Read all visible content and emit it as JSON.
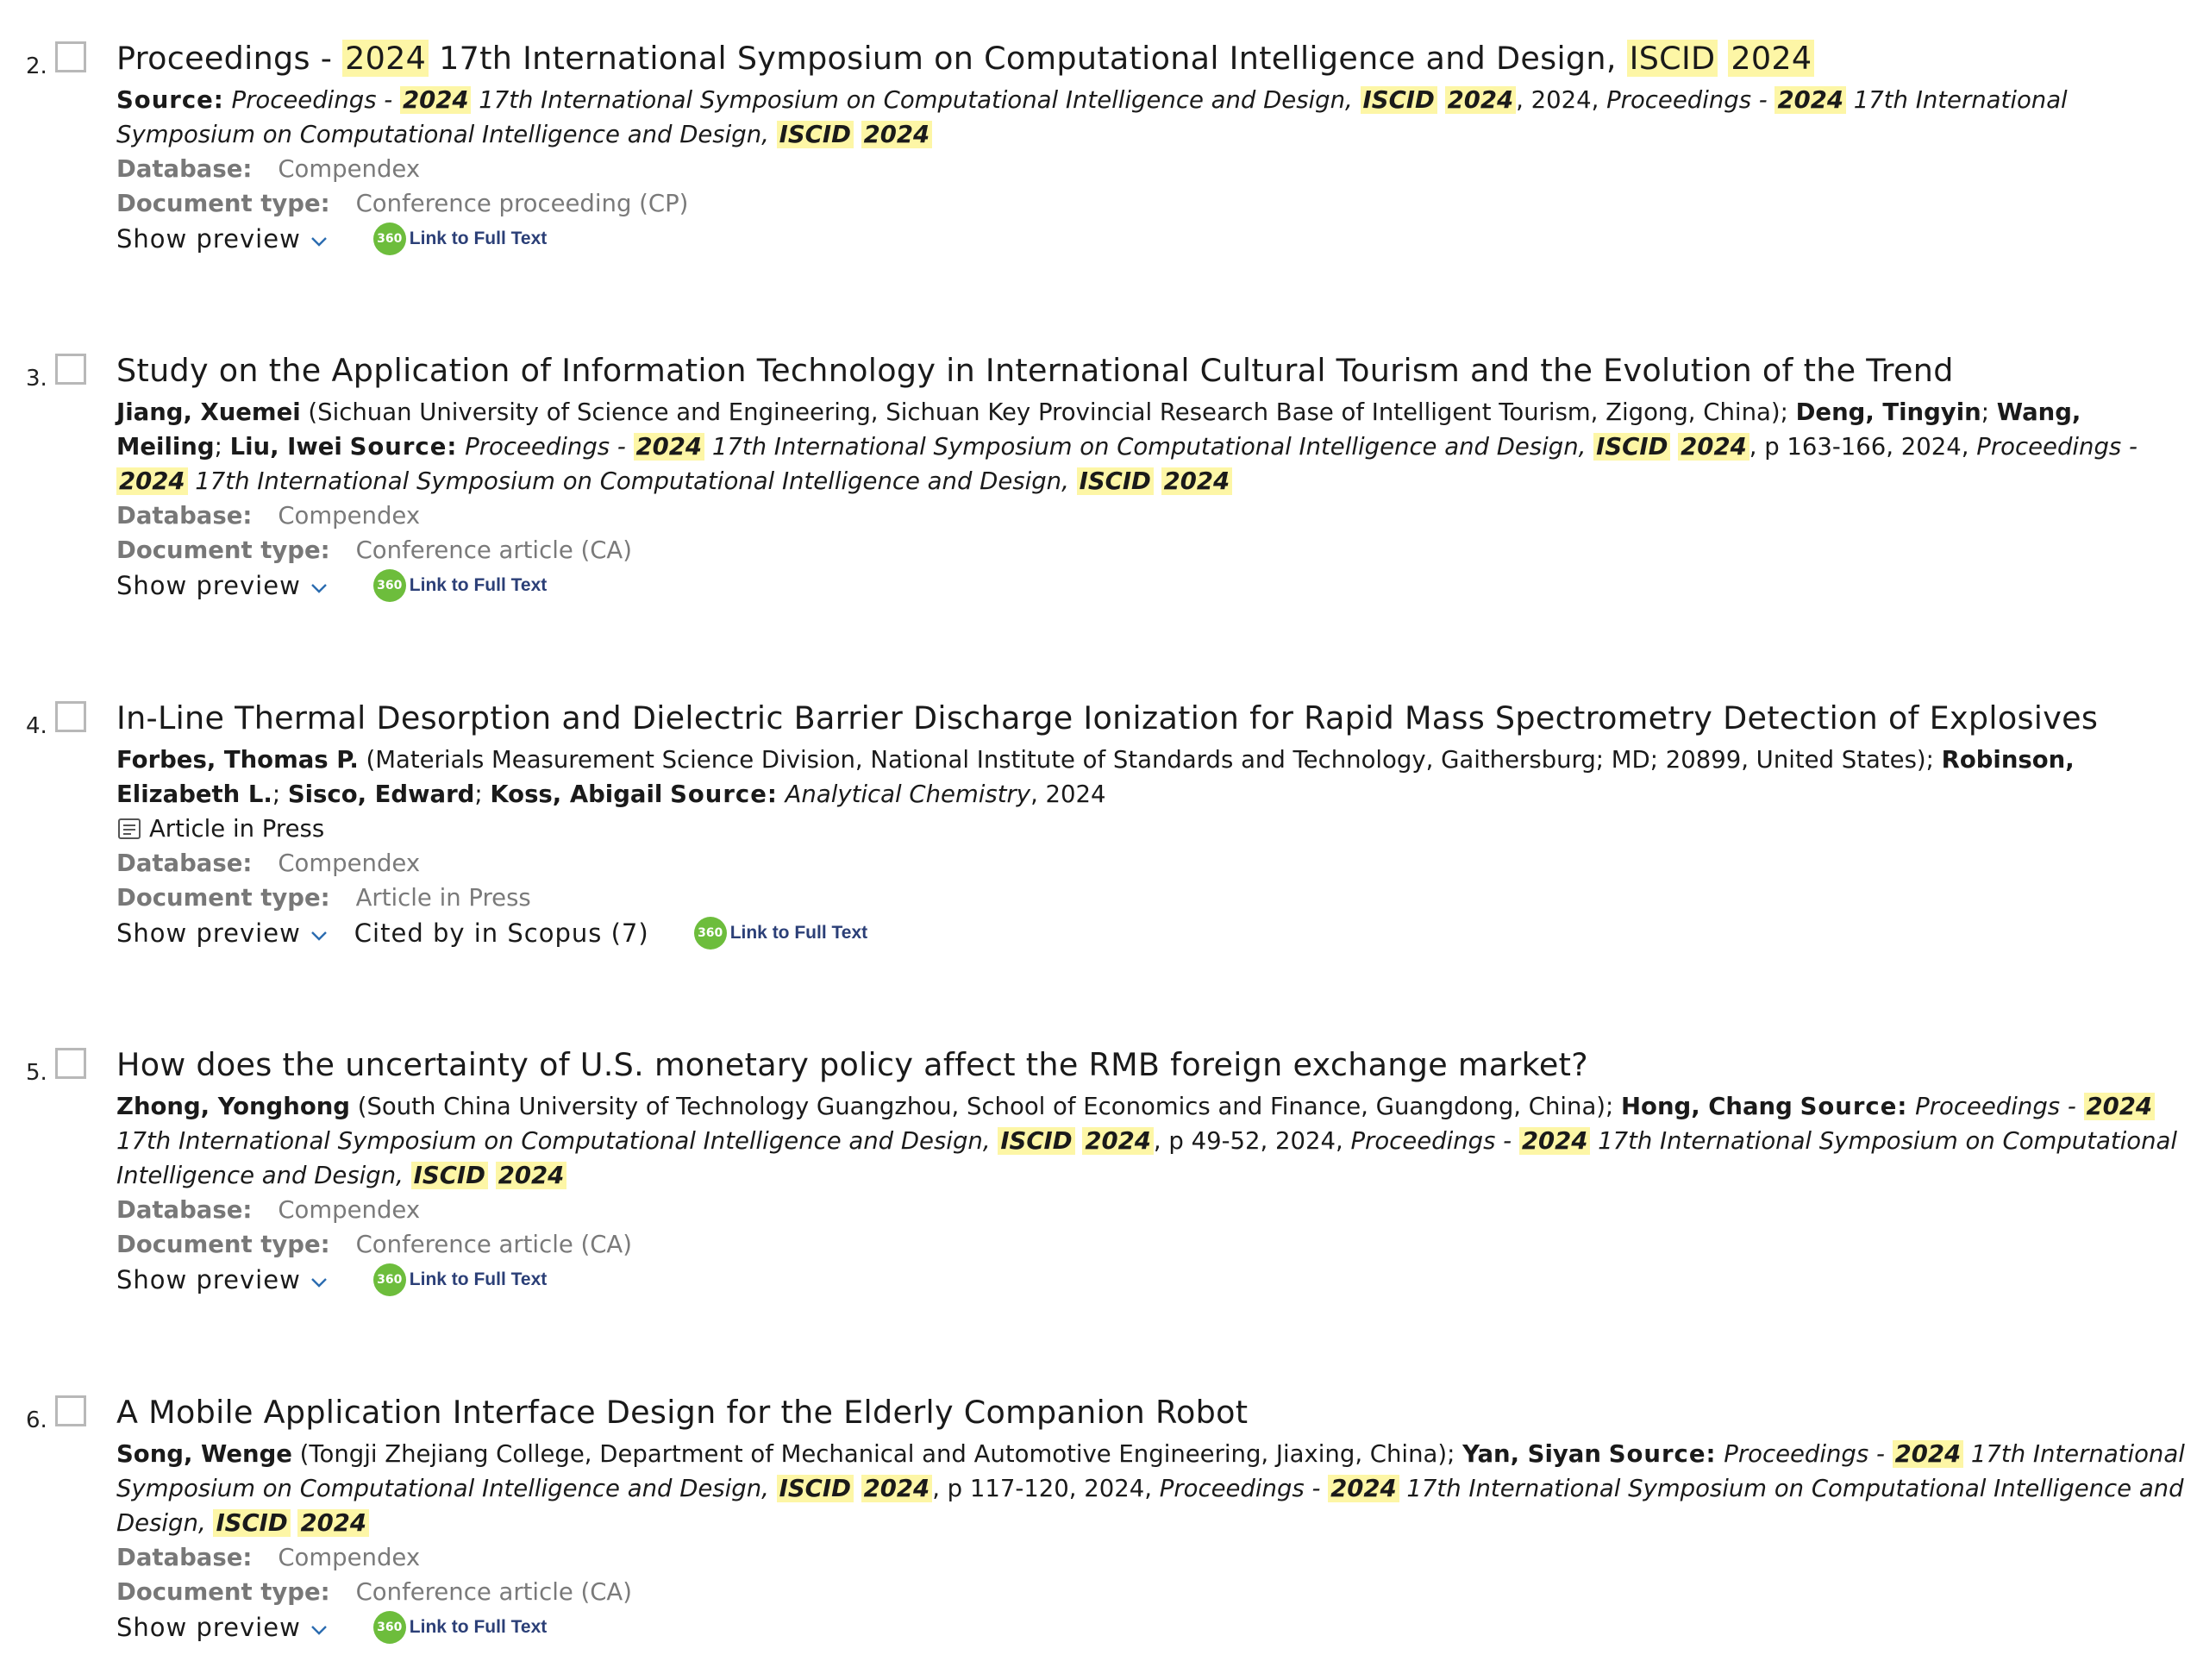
{
  "ui": {
    "labels": {
      "source": "Source:",
      "database": "Database:",
      "doctype": "Document type:",
      "show_preview": "Show preview",
      "full_text_badge": "360",
      "full_text": "Link to Full Text"
    }
  },
  "results": [
    {
      "number": "2.",
      "title": [
        {
          "t": "Proceedings - "
        },
        {
          "t": "2024",
          "hl": 1
        },
        {
          "t": " 17th International Symposium on Computational Intelligence and Design, "
        },
        {
          "t": "ISCID",
          "hl": 1
        },
        {
          "t": " "
        },
        {
          "t": "2024",
          "hl": 1
        }
      ],
      "citation": [
        {
          "t": "Source:",
          "s": "lbl"
        },
        {
          "t": " "
        },
        {
          "t": "Proceedings - ",
          "s": "i"
        },
        {
          "t": "2024",
          "s": "i",
          "hl": 1,
          "b": 1
        },
        {
          "t": " 17th International Symposium on Computational Intelligence and Design, ",
          "s": "i"
        },
        {
          "t": "ISCID",
          "s": "i",
          "hl": 1,
          "b": 1
        },
        {
          "t": " ",
          "s": "i"
        },
        {
          "t": "2024",
          "s": "i",
          "hl": 1,
          "b": 1
        },
        {
          "t": ", 2024, "
        },
        {
          "t": "Proceedings - ",
          "s": "i"
        },
        {
          "t": "2024",
          "s": "i",
          "hl": 1,
          "b": 1
        },
        {
          "t": " 17th International Symposium on Computational Intelligence and Design, ",
          "s": "i"
        },
        {
          "t": "ISCID",
          "s": "i",
          "hl": 1,
          "b": 1
        },
        {
          "t": " ",
          "s": "i"
        },
        {
          "t": "2024",
          "s": "i",
          "hl": 1,
          "b": 1
        }
      ],
      "status": "",
      "database": "Compendex",
      "doctype": "Conference proceeding (CP)",
      "cited_by": ""
    },
    {
      "number": "3.",
      "title": [
        {
          "t": "Study on the Application of Information Technology in International Cultural Tourism and the Evolution of the Trend"
        }
      ],
      "citation": [
        {
          "t": "Jiang, Xuemei",
          "s": "b"
        },
        {
          "t": " (Sichuan University of Science and Engineering, Sichuan Key Provincial Research Base of Intelligent Tourism, Zigong, China); "
        },
        {
          "t": "Deng, Tingyin",
          "s": "b"
        },
        {
          "t": "; "
        },
        {
          "t": "Wang, Meiling",
          "s": "b"
        },
        {
          "t": "; "
        },
        {
          "t": "Liu, Iwei",
          "s": "b"
        },
        {
          "t": " "
        },
        {
          "t": "Source:",
          "s": "lbl"
        },
        {
          "t": " "
        },
        {
          "t": "Proceedings - ",
          "s": "i"
        },
        {
          "t": "2024",
          "s": "i",
          "hl": 1,
          "b": 1
        },
        {
          "t": " 17th International Symposium on Computational Intelligence and Design, ",
          "s": "i"
        },
        {
          "t": "ISCID",
          "s": "i",
          "hl": 1,
          "b": 1
        },
        {
          "t": " ",
          "s": "i"
        },
        {
          "t": "2024",
          "s": "i",
          "hl": 1,
          "b": 1
        },
        {
          "t": ", p 163-166, 2024, "
        },
        {
          "t": "Proceedings - ",
          "s": "i"
        },
        {
          "t": "2024",
          "s": "i",
          "hl": 1,
          "b": 1
        },
        {
          "t": " 17th International Symposium on Computational Intelligence and Design, ",
          "s": "i"
        },
        {
          "t": "ISCID",
          "s": "i",
          "hl": 1,
          "b": 1
        },
        {
          "t": " ",
          "s": "i"
        },
        {
          "t": "2024",
          "s": "i",
          "hl": 1,
          "b": 1
        }
      ],
      "status": "",
      "database": "Compendex",
      "doctype": "Conference article (CA)",
      "cited_by": ""
    },
    {
      "number": "4.",
      "title": [
        {
          "t": "In-Line Thermal Desorption and Dielectric Barrier Discharge Ionization for Rapid Mass Spectrometry Detection of Explosives"
        }
      ],
      "citation": [
        {
          "t": "Forbes, Thomas P.",
          "s": "b"
        },
        {
          "t": " (Materials Measurement Science Division, National Institute of Standards and Technology, Gaithersburg; MD; 20899, United States); "
        },
        {
          "t": "Robinson, Elizabeth L.",
          "s": "b"
        },
        {
          "t": "; "
        },
        {
          "t": "Sisco, Edward",
          "s": "b"
        },
        {
          "t": "; "
        },
        {
          "t": "Koss, Abigail",
          "s": "b"
        },
        {
          "t": " "
        },
        {
          "t": "Source:",
          "s": "lbl"
        },
        {
          "t": " "
        },
        {
          "t": "Analytical Chemistry",
          "s": "i"
        },
        {
          "t": ", 2024"
        }
      ],
      "status": "Article in Press",
      "database": "Compendex",
      "doctype": "Article in Press",
      "cited_by": "Cited by in Scopus (7)"
    },
    {
      "number": "5.",
      "title": [
        {
          "t": "How does the uncertainty of U.S. monetary policy affect the RMB foreign exchange market?"
        }
      ],
      "citation": [
        {
          "t": "Zhong, Yonghong",
          "s": "b"
        },
        {
          "t": " (South China University of Technology Guangzhou, School of Economics and Finance, Guangdong, China); "
        },
        {
          "t": "Hong, Chang",
          "s": "b"
        },
        {
          "t": " "
        },
        {
          "t": "Source:",
          "s": "lbl"
        },
        {
          "t": " "
        },
        {
          "t": "Proceedings - ",
          "s": "i"
        },
        {
          "t": "2024",
          "s": "i",
          "hl": 1,
          "b": 1
        },
        {
          "t": " 17th International Symposium on Computational Intelligence and Design, ",
          "s": "i"
        },
        {
          "t": "ISCID",
          "s": "i",
          "hl": 1,
          "b": 1
        },
        {
          "t": " ",
          "s": "i"
        },
        {
          "t": "2024",
          "s": "i",
          "hl": 1,
          "b": 1
        },
        {
          "t": ", p 49-52, 2024, "
        },
        {
          "t": "Proceedings - ",
          "s": "i"
        },
        {
          "t": "2024",
          "s": "i",
          "hl": 1,
          "b": 1
        },
        {
          "t": " 17th International Symposium on Computational Intelligence and Design, ",
          "s": "i"
        },
        {
          "t": "ISCID",
          "s": "i",
          "hl": 1,
          "b": 1
        },
        {
          "t": " ",
          "s": "i"
        },
        {
          "t": "2024",
          "s": "i",
          "hl": 1,
          "b": 1
        }
      ],
      "status": "",
      "database": "Compendex",
      "doctype": "Conference article (CA)",
      "cited_by": ""
    },
    {
      "number": "6.",
      "title": [
        {
          "t": "A Mobile Application Interface Design for the Elderly Companion Robot"
        }
      ],
      "citation": [
        {
          "t": "Song, Wenge",
          "s": "b"
        },
        {
          "t": " (Tongji Zhejiang College, Department of Mechanical and Automotive Engineering, Jiaxing, China); "
        },
        {
          "t": "Yan, Siyan",
          "s": "b"
        },
        {
          "t": " "
        },
        {
          "t": "Source:",
          "s": "lbl"
        },
        {
          "t": " "
        },
        {
          "t": "Proceedings - ",
          "s": "i"
        },
        {
          "t": "2024",
          "s": "i",
          "hl": 1,
          "b": 1
        },
        {
          "t": " 17th International Symposium on Computational Intelligence and Design, ",
          "s": "i"
        },
        {
          "t": "ISCID",
          "s": "i",
          "hl": 1,
          "b": 1
        },
        {
          "t": " ",
          "s": "i"
        },
        {
          "t": "2024",
          "s": "i",
          "hl": 1,
          "b": 1
        },
        {
          "t": ", p 117-120, 2024, "
        },
        {
          "t": "Proceedings - ",
          "s": "i"
        },
        {
          "t": "2024",
          "s": "i",
          "hl": 1,
          "b": 1
        },
        {
          "t": " 17th International Symposium on Computational Intelligence and Design, ",
          "s": "i"
        },
        {
          "t": "ISCID",
          "s": "i",
          "hl": 1,
          "b": 1
        },
        {
          "t": " ",
          "s": "i"
        },
        {
          "t": "2024",
          "s": "i",
          "hl": 1,
          "b": 1
        }
      ],
      "status": "",
      "database": "Compendex",
      "doctype": "Conference article (CA)",
      "cited_by": ""
    }
  ]
}
